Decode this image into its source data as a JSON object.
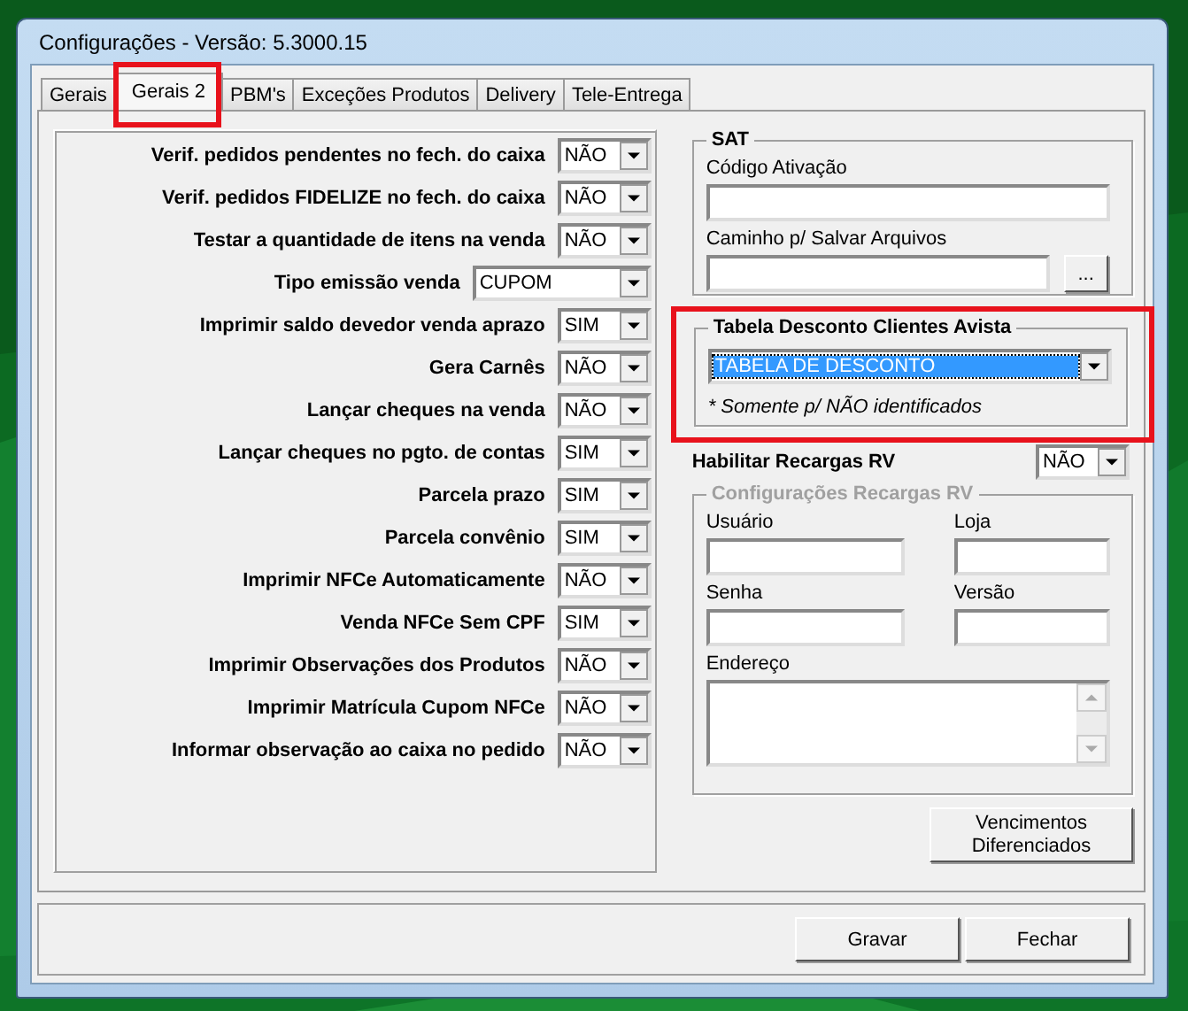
{
  "window": {
    "title": "Configurações - Versão: 5.3000.15"
  },
  "tabs": [
    {
      "label": "Gerais",
      "selected": false,
      "highlighted": false
    },
    {
      "label": "Gerais 2",
      "selected": true,
      "highlighted": true
    },
    {
      "label": "PBM's",
      "selected": false,
      "highlighted": false
    },
    {
      "label": "Exceções Produtos",
      "selected": false,
      "highlighted": false
    },
    {
      "label": "Delivery",
      "selected": false,
      "highlighted": false
    },
    {
      "label": "Tele-Entrega",
      "selected": false,
      "highlighted": false
    }
  ],
  "settings": [
    {
      "label": "Verif. pedidos pendentes no fech. do caixa",
      "value": "NÃO",
      "kind": "narrow"
    },
    {
      "label": "Verif. pedidos FIDELIZE no fech. do caixa",
      "value": "NÃO",
      "kind": "narrow"
    },
    {
      "label": "Testar a quantidade de itens na venda",
      "value": "NÃO",
      "kind": "narrow"
    },
    {
      "label": "Tipo emissão venda",
      "value": "CUPOM",
      "kind": "wide"
    },
    {
      "label": "Imprimir saldo devedor venda aprazo",
      "value": "SIM",
      "kind": "narrow"
    },
    {
      "label": "Gera Carnês",
      "value": "NÃO",
      "kind": "narrow"
    },
    {
      "label": "Lançar cheques na venda",
      "value": "NÃO",
      "kind": "narrow"
    },
    {
      "label": "Lançar cheques no pgto. de contas",
      "value": "SIM",
      "kind": "narrow"
    },
    {
      "label": "Parcela prazo",
      "value": "SIM",
      "kind": "narrow"
    },
    {
      "label": "Parcela convênio",
      "value": "SIM",
      "kind": "narrow"
    },
    {
      "label": "Imprimir NFCe Automaticamente",
      "value": "NÃO",
      "kind": "narrow"
    },
    {
      "label": "Venda NFCe Sem CPF",
      "value": "SIM",
      "kind": "narrow"
    },
    {
      "label": "Imprimir Observações dos Produtos",
      "value": "NÃO",
      "kind": "narrow"
    },
    {
      "label": "Imprimir Matrícula Cupom NFCe",
      "value": "NÃO",
      "kind": "narrow"
    },
    {
      "label": "Informar observação ao caixa no pedido",
      "value": "NÃO",
      "kind": "narrow"
    }
  ],
  "sat": {
    "title": "SAT",
    "activation_code": {
      "label": "Código Ativação"
    },
    "save_path": {
      "label": "Caminho p/ Salvar Arquivos",
      "browse_button": "..."
    }
  },
  "discount_table": {
    "title": "Tabela Desconto Clientes Avista",
    "value": "TABELA DE DESCONTO",
    "focused": true,
    "note": "* Somente p/ NÃO identificados",
    "highlighted": true
  },
  "recharge": {
    "label": "Habilitar Recargas RV",
    "value": "NÃO"
  },
  "recharge_config": {
    "title": "Configurações Recargas RV",
    "disabled": true,
    "fields": [
      {
        "label": "Usuário"
      },
      {
        "label": "Loja"
      },
      {
        "label": "Senha"
      },
      {
        "label": "Versão"
      }
    ],
    "address": {
      "label": "Endereço"
    }
  },
  "due_dates_button": "Vencimentos Diferenciados",
  "buttons": [
    "Gravar",
    "Fechar"
  ]
}
